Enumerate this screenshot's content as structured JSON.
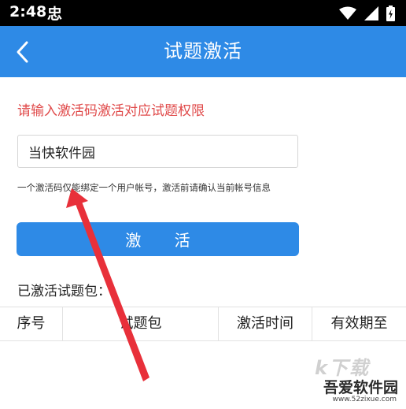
{
  "status_bar": {
    "time": "2:48",
    "carrier_glyph": "忠",
    "icons": [
      "wifi-icon",
      "signal-icon",
      "battery-charging-icon"
    ]
  },
  "app_bar": {
    "title": "试题激活",
    "back_icon": "chevron-left-icon",
    "color": "#2e8ae6"
  },
  "form": {
    "prompt": "请输入激活码激活对应试题权限",
    "prompt_color": "#e04a4a",
    "input_value": "当快软件园",
    "note": "一个激活码仅能绑定一个用户帐号，激活前请确认当前帐号信息",
    "activate_label": "激 活"
  },
  "activated": {
    "section_label": "已激活试题包：",
    "columns": [
      "序号",
      "试题包",
      "激活时间",
      "有效期至"
    ],
    "rows": []
  },
  "watermark": {
    "logo_text": "k下载",
    "brand": "吾爱软件园",
    "url": "www.52zixue.com"
  }
}
